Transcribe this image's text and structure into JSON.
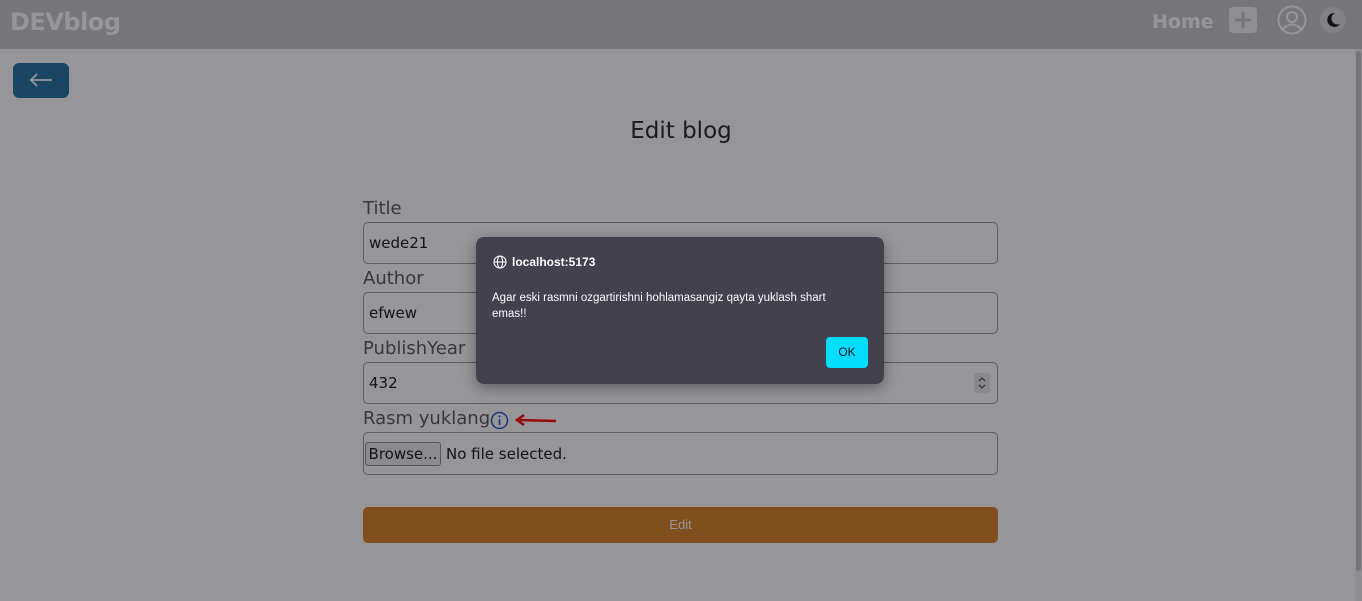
{
  "navbar": {
    "brand": "DEVblog",
    "home_label": "Home",
    "add_icon": "plus-icon",
    "user_icon": "user-icon",
    "theme_icon": "moon-icon"
  },
  "page": {
    "back_icon": "arrow-left-icon",
    "title": "Edit blog"
  },
  "form": {
    "title_label": "Title",
    "title_value": "wede21",
    "author_label": "Author",
    "author_value": "efwew",
    "year_label": "PublishYear",
    "year_value": "432",
    "image_label": "Rasm yuklang",
    "browse_label": "Browse...",
    "file_status": "No file selected.",
    "submit_label": "Edit"
  },
  "dialog": {
    "origin": "localhost:5173",
    "message": "Agar eski rasmni ozgartirishni hohlamasangiz qayta yuklash shart emas!!",
    "ok_label": "OK"
  },
  "colors": {
    "navbar": "#c7c7c7",
    "back_button": "#1e6e9e",
    "submit_button": "#d97c1e",
    "dialog_bg": "#42414d",
    "ok_button": "#00ddff",
    "annotation_arrow": "#ff0000"
  }
}
